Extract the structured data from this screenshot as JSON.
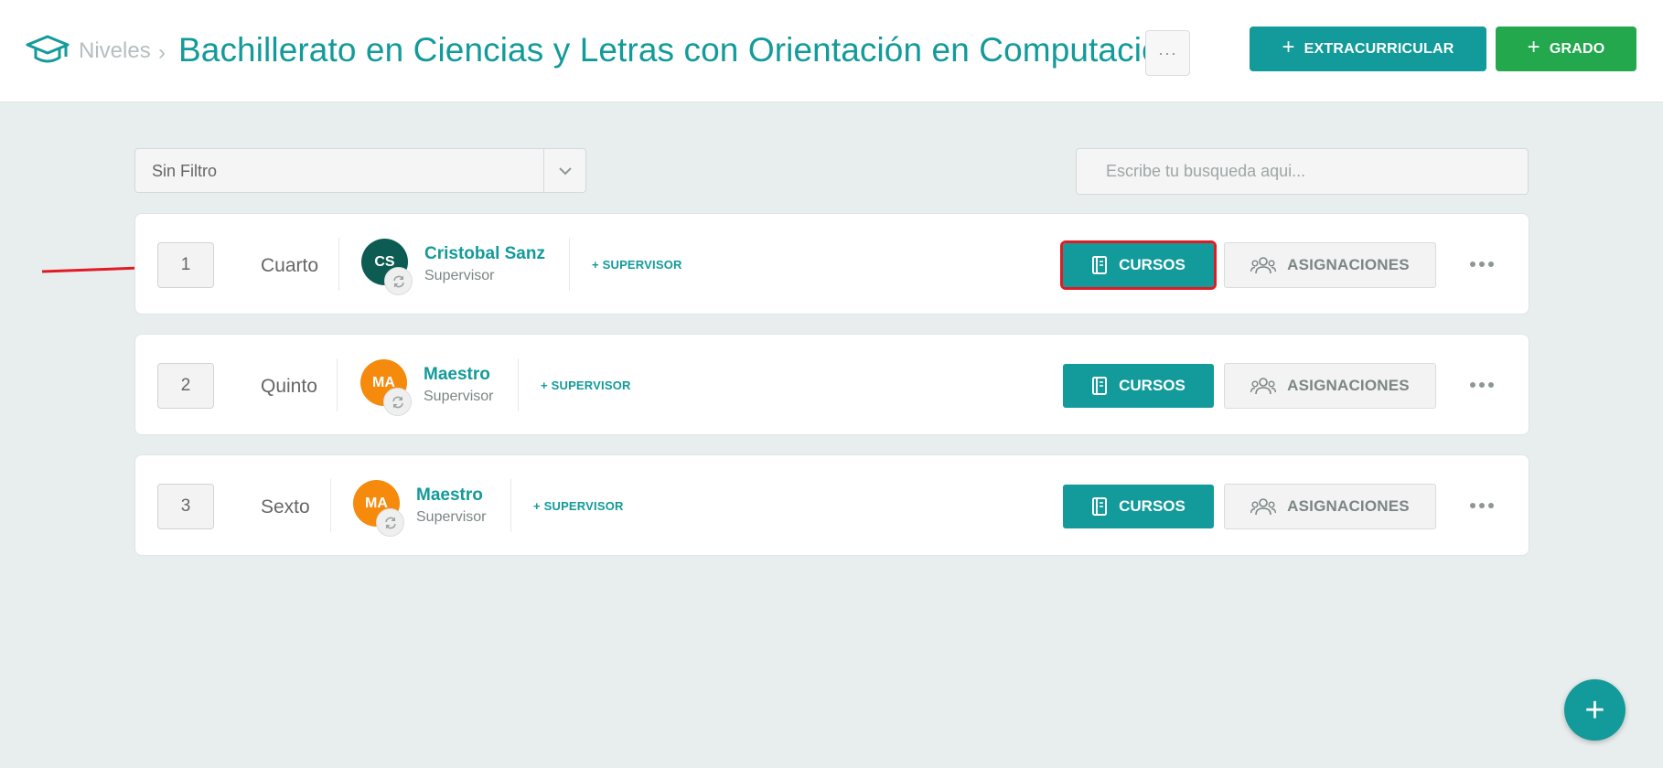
{
  "header": {
    "icon": "graduation-cap-icon",
    "breadcrumb_root": "Niveles",
    "breadcrumb_sep": "›",
    "title": "Bachillerato en Ciencias y Letras con Orientación en Computación",
    "more_label": "···",
    "extracurricular_label": "EXTRACURRICULAR",
    "grado_label": "GRADO",
    "plus": "+"
  },
  "filter": {
    "selected": "Sin Filtro"
  },
  "search": {
    "placeholder": "Escribe tu busqueda aqui..."
  },
  "grades": [
    {
      "number": "1",
      "name": "Cuarto",
      "avatar_initials": "CS",
      "avatar_color": "#0d5c53",
      "supervisor_name": "Cristobal Sanz",
      "supervisor_role": "Supervisor",
      "add_supervisor": "+ SUPERVISOR",
      "cursos_label": "CURSOS",
      "asignaciones_label": "ASIGNACIONES",
      "highlighted": true
    },
    {
      "number": "2",
      "name": "Quinto",
      "avatar_initials": "MA",
      "avatar_color": "#f58a0d",
      "supervisor_name": "Maestro",
      "supervisor_role": "Supervisor",
      "add_supervisor": "+ SUPERVISOR",
      "cursos_label": "CURSOS",
      "asignaciones_label": "ASIGNACIONES",
      "highlighted": false
    },
    {
      "number": "3",
      "name": "Sexto",
      "avatar_initials": "MA",
      "avatar_color": "#f58a0d",
      "supervisor_name": "Maestro",
      "supervisor_role": "Supervisor",
      "add_supervisor": "+ SUPERVISOR",
      "cursos_label": "CURSOS",
      "asignaciones_label": "ASIGNACIONES",
      "highlighted": false
    }
  ],
  "fab": {
    "label": "+"
  },
  "colors": {
    "accent": "#139a9a",
    "success": "#23a84d",
    "highlight": "#e01b24",
    "background": "#e8eeee"
  }
}
